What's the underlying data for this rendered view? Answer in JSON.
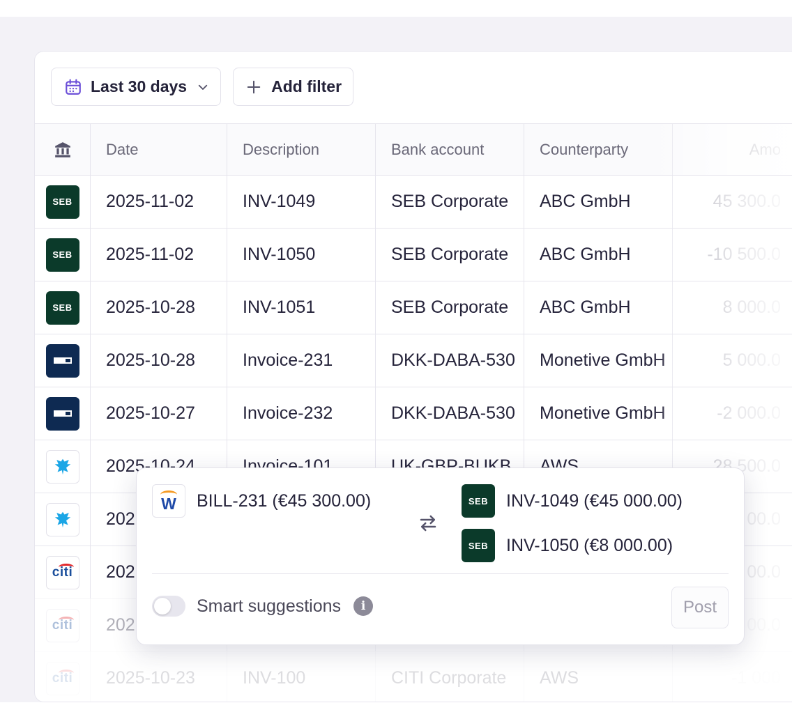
{
  "toolbar": {
    "date_range_label": "Last 30 days",
    "add_filter_label": "Add filter"
  },
  "table": {
    "columns": [
      "",
      "Date",
      "Description",
      "Bank account",
      "Counterparty",
      "Amo"
    ],
    "rows": [
      {
        "bank_logo": "SEB",
        "date": "2025-11-02",
        "description": "INV-1049",
        "bank_account": "SEB Corporate",
        "counterparty": "ABC GmbH",
        "amount": "45 300.0"
      },
      {
        "bank_logo": "SEB",
        "date": "2025-11-02",
        "description": "INV-1050",
        "bank_account": "SEB Corporate",
        "counterparty": "ABC GmbH",
        "amount": "-10 500.0"
      },
      {
        "bank_logo": "SEB",
        "date": "2025-10-28",
        "description": "INV-1051",
        "bank_account": "SEB Corporate",
        "counterparty": "ABC GmbH",
        "amount": "8 000.0"
      },
      {
        "bank_logo": "danske-icon",
        "date": "2025-10-28",
        "description": "Invoice-231",
        "bank_account": "DKK-DABA-530",
        "counterparty": "Monetive GmbH",
        "amount": "5 000.0"
      },
      {
        "bank_logo": "danske-icon",
        "date": "2025-10-27",
        "description": "Invoice-232",
        "bank_account": "DKK-DABA-530",
        "counterparty": "Monetive GmbH",
        "amount": "-2 000.0"
      },
      {
        "bank_logo": "barclays-eagle-icon",
        "date": "2025-10-24",
        "description": "Invoice-101",
        "bank_account": "UK-GBP-BUKB",
        "counterparty": "AWS",
        "amount": "28 500.0"
      },
      {
        "bank_logo": "barclays-eagle-icon",
        "date": "202",
        "description": "",
        "bank_account": "",
        "counterparty": "",
        "amount": "00.0"
      },
      {
        "bank_logo": "citi",
        "date": "202",
        "description": "",
        "bank_account": "",
        "counterparty": "",
        "amount": "00.0"
      },
      {
        "bank_logo": "citi",
        "date": "202",
        "description": "",
        "bank_account": "",
        "counterparty": "",
        "amount": "00.0"
      },
      {
        "bank_logo": "citi",
        "date": "2025-10-23",
        "description": "INV-100",
        "bank_account": "CITI Corporate",
        "counterparty": "AWS",
        "amount": "-1 000"
      }
    ]
  },
  "match_popup": {
    "bill_logo_letter": "W",
    "bill_label": "BILL-231 (€45 300.00)",
    "matches": [
      {
        "logo": "SEB",
        "label": "INV-1049 (€45 000.00)"
      },
      {
        "logo": "SEB",
        "label": "INV-1050 (€8 000.00)"
      }
    ],
    "smart_suggestions_label": "Smart suggestions",
    "smart_suggestions_enabled": false,
    "post_label": "Post"
  },
  "colors": {
    "seb_green": "#0b3a2a",
    "danske_navy": "#0e2a52",
    "accent_purple": "#6b4fd8"
  }
}
